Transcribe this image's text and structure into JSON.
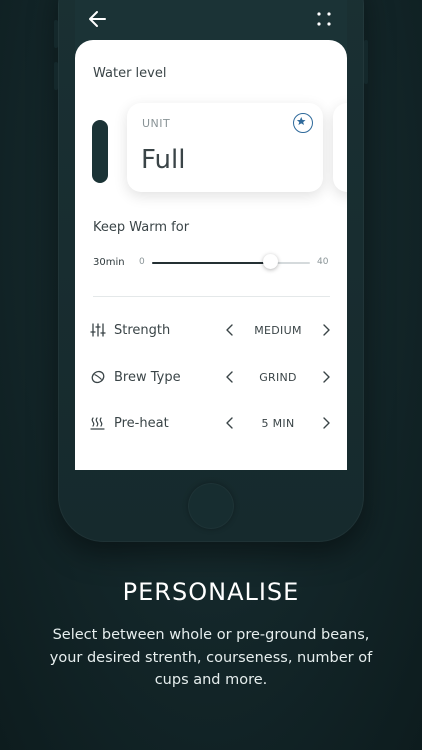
{
  "screen": {
    "water_level": {
      "title": "Water level",
      "unit_label": "UNIT",
      "value": "Full"
    },
    "keep_warm": {
      "title": "Keep Warm for",
      "current": "30min",
      "min": "0",
      "max": "40",
      "value_minutes": 30
    },
    "settings": [
      {
        "icon": "sliders-icon",
        "label": "Strength",
        "value": "MEDIUM"
      },
      {
        "icon": "coffee-bean-icon",
        "label": "Brew Type",
        "value": "GRIND"
      },
      {
        "icon": "heat-waves-icon",
        "label": "Pre-heat",
        "value": "5 MIN"
      }
    ]
  },
  "promo": {
    "headline": "PERSONALISE",
    "description": "Select between whole or pre-ground beans, your desired strenth, courseness, number of cups and more."
  },
  "colors": {
    "background": "#132629",
    "accent_dark": "#1b3336",
    "star": "#2f6a9b"
  }
}
